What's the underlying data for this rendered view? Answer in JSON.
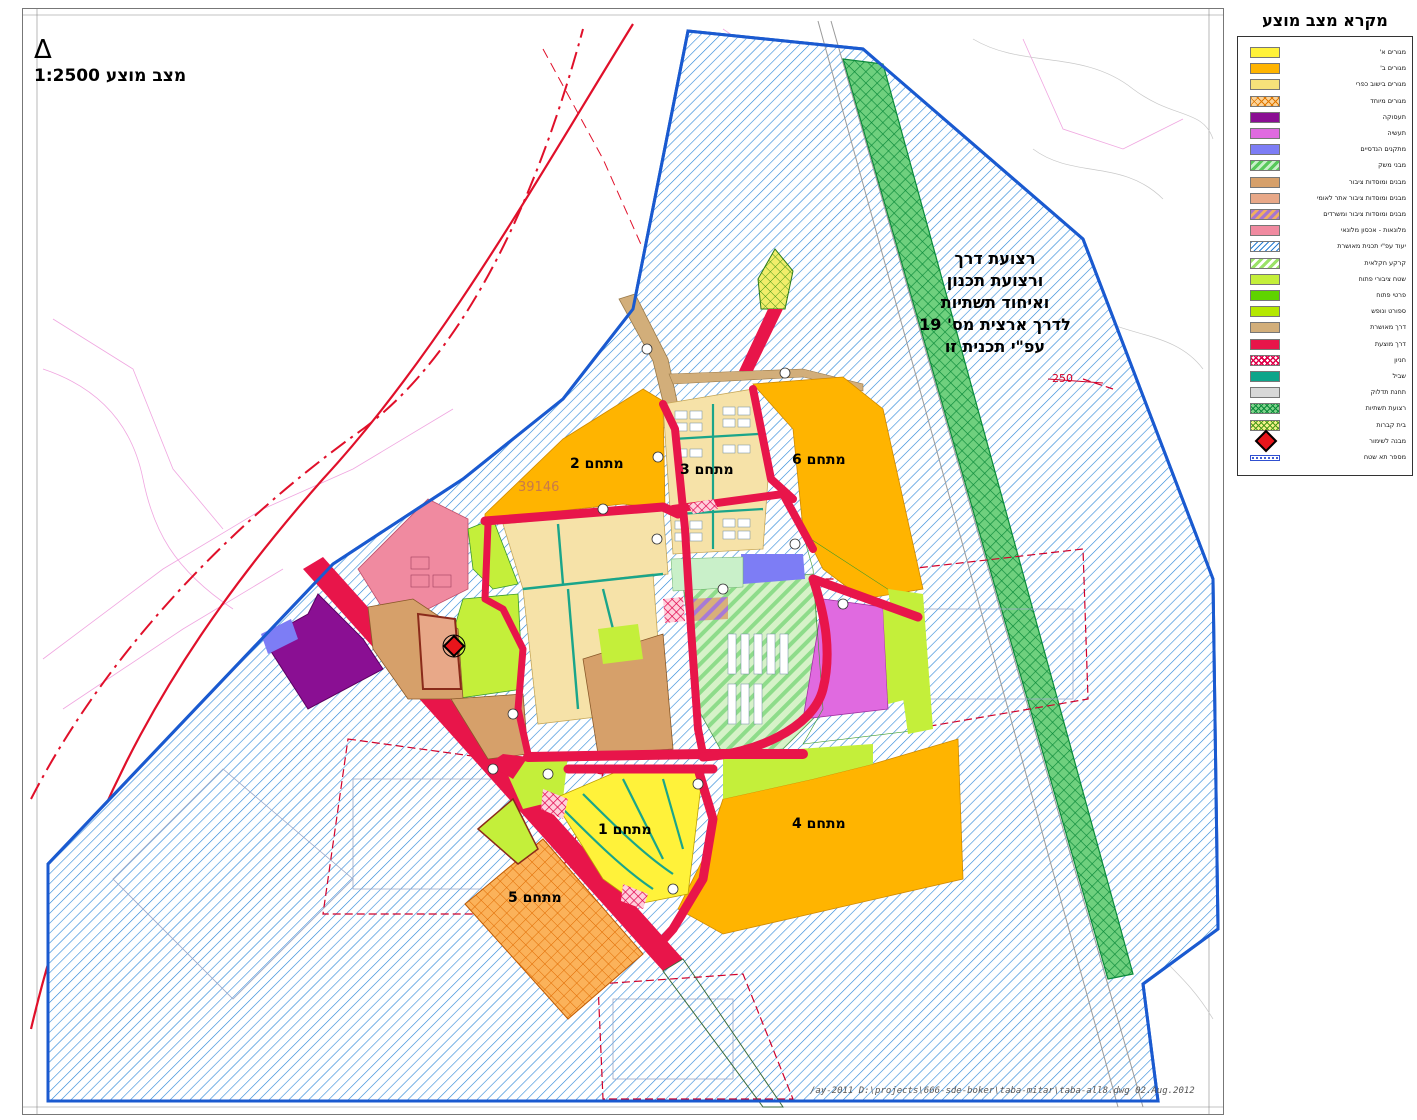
{
  "map": {
    "title": "מצב מוצע 1:2500",
    "parcel_number": "39146",
    "areas": [
      {
        "id": "area-1",
        "label": "מתחם 1"
      },
      {
        "id": "area-2",
        "label": "מתחם 2"
      },
      {
        "id": "area-3",
        "label": "מתחם 3"
      },
      {
        "id": "area-4",
        "label": "מתחם 4"
      },
      {
        "id": "area-5",
        "label": "מתחם 5"
      },
      {
        "id": "area-6",
        "label": "מתחם 6"
      }
    ],
    "road_note": [
      "רצועת דרך",
      "ורצועת תכנון",
      "ואיחוד תשתיות",
      "לדרך ארצית מס' 19",
      "עפ\"י תכנית זו"
    ],
    "road_marker": "250",
    "footer_path": "/ay-2011     D:\\projects\\666-sde-boker\\taba-mitar\\taba-all8.dwg       02.Aug.2012"
  },
  "legend": {
    "title": "מקרא מצב מוצע",
    "items": [
      {
        "label": "מגורים א'",
        "swatch": "#fff23a"
      },
      {
        "label": "מגורים ב'",
        "swatch": "#ffb400"
      },
      {
        "label": "מגורים בישוב כפרי",
        "swatch": "#f6e27a"
      },
      {
        "label": "מגורים מיוחד",
        "swatch": "hatch-orange"
      },
      {
        "label": "תעסוקה",
        "swatch": "#8a0f93"
      },
      {
        "label": "תעשיה",
        "swatch": "#e06ae0"
      },
      {
        "label": "מתקנים הנדסיים",
        "swatch": "#7d7df5"
      },
      {
        "label": "מבני משק",
        "swatch": "stripe-green"
      },
      {
        "label": "מבנים ומוסדות ציבור",
        "swatch": "#d6a06a"
      },
      {
        "label": "מבנים ומוסדות ציבור אתר לאומי",
        "swatch": "#e8a888"
      },
      {
        "label": "מבנים ומוסדות ציבור ומשרדים",
        "swatch": "stripe-purple"
      },
      {
        "label": "מלונאות - אכסון מלונאי",
        "swatch": "#f08aa0"
      },
      {
        "label": "יעוד עפ\"י תכנית מאושרת",
        "swatch": "hatch-blue"
      },
      {
        "label": "קרקע חקלאית",
        "swatch": "stripe-lime"
      },
      {
        "label": "שטח ציבורי פתוח",
        "swatch": "#c4ef3a"
      },
      {
        "label": "פרטי פתוח",
        "swatch": "#5fd400"
      },
      {
        "label": "ספורט ונופש",
        "swatch": "#b5e800"
      },
      {
        "label": "דרך מאושרת",
        "swatch": "#d2ae7a"
      },
      {
        "label": "דרך מוצעת",
        "swatch": "#e8154a"
      },
      {
        "label": "חניון",
        "swatch": "hatch-red"
      },
      {
        "label": "שביל",
        "swatch": "#0da58a"
      },
      {
        "label": "תחנת תדלוק",
        "swatch": "#d8d8d8"
      },
      {
        "label": "רצועת תשתיות",
        "swatch": "hatch-green"
      },
      {
        "label": "בית קברות",
        "swatch": "hatch-yellow"
      },
      {
        "label": "מבנה לשימור",
        "swatch": "diamond"
      },
      {
        "label": "מספר תא שטח",
        "swatch": "dots"
      }
    ]
  }
}
